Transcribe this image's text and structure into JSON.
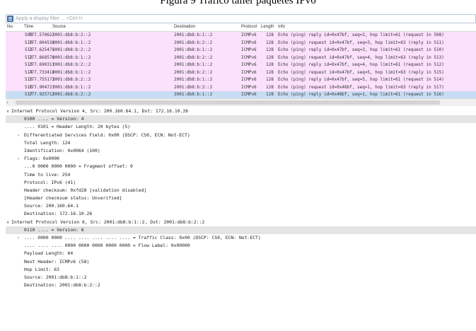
{
  "caption": "Figura 9 Tráfico taller paquetes IPv6",
  "filter": {
    "placeholder": "Apply a display filter ... <Ctrl-/>"
  },
  "columns": {
    "no": "No.",
    "time": "Time",
    "source": "Source",
    "destination": "Destination",
    "protocol": "Protocol",
    "length": "Length",
    "info": "Info"
  },
  "packets": [
    {
      "no": "509",
      "time": "777.570622",
      "src": "2001:db8:b:2::2",
      "dst": "2001:db8:b:1::2",
      "proto": "ICMPv6",
      "len": "128",
      "info": "Echo (ping) reply id=0x47bf, seq=2, hop limit=61 (request in 508)"
    },
    {
      "no": "510",
      "time": "777.604530",
      "src": "2001:db8:b:1::2",
      "dst": "2001:db8:b:2::2",
      "proto": "ICMPv6",
      "len": "128",
      "info": "Echo (ping) request id=0x47bf, seq=3, hop limit=63 (reply in 511)"
    },
    {
      "no": "511",
      "time": "777.625475",
      "src": "2001:db8:b:2::2",
      "dst": "2001:db8:b:1::2",
      "proto": "ICMPv6",
      "len": "128",
      "info": "Echo (ping) reply id=0x47bf, seq=3, hop limit=61 (request in 510)"
    },
    {
      "no": "512",
      "time": "777.668570",
      "src": "2001:db8:b:1::2",
      "dst": "2001:db8:b:2::2",
      "proto": "ICMPv6",
      "len": "128",
      "info": "Echo (ping) request id=0x47bf, seq=4, hop limit=63 (reply in 513)"
    },
    {
      "no": "513",
      "time": "777.690311",
      "src": "2001:db8:b:2::2",
      "dst": "2001:db8:b:1::2",
      "proto": "ICMPv6",
      "len": "128",
      "info": "Echo (ping) reply id=0x47bf, seq=4, hop limit=61 (request in 512)"
    },
    {
      "no": "514",
      "time": "777.733410",
      "src": "2001:db8:b:1::2",
      "dst": "2001:db8:b:2::2",
      "proto": "ICMPv6",
      "len": "128",
      "info": "Echo (ping) request id=0x47bf, seq=5, hop limit=63 (reply in 515)"
    },
    {
      "no": "515",
      "time": "777.755173",
      "src": "2001:db8:b:2::2",
      "dst": "2001:db8:b:1::2",
      "proto": "ICMPv6",
      "len": "128",
      "info": "Echo (ping) reply id=0x47bf, seq=5, hop limit=61 (request in 514)"
    },
    {
      "no": "516",
      "time": "777.904727",
      "src": "2001:db8:b:1::2",
      "dst": "2001:db8:b:2::2",
      "proto": "ICMPv6",
      "len": "128",
      "info": "Echo (ping) request id=0x48bf, seq=1, hop limit=63 (reply in 517)"
    },
    {
      "no": "517",
      "time": "777.925712",
      "src": "2001:db8:b:2::2",
      "dst": "2001:db8:b:1::2",
      "proto": "ICMPv6",
      "len": "128",
      "info": "Echo (ping) reply id=0x48bf, seq=1, hop limit=61 (request in 516)"
    }
  ],
  "details": [
    {
      "tw": "∨",
      "text": "Internet Protocol Version 4, Src: 200.160.64.1, Dst: 172.16.10.26",
      "indent": 0
    },
    {
      "tw": "",
      "text": "0100 .... = Version: 4",
      "indent": 1,
      "hl": true
    },
    {
      "tw": "",
      "text": ".... 0101 = Header Length: 20 bytes (5)",
      "indent": 1
    },
    {
      "tw": "›",
      "text": "Differentiated Services Field: 0x00 (DSCP: CS0, ECN: Not-ECT)",
      "indent": 1
    },
    {
      "tw": "",
      "text": "Total Length: 124",
      "indent": 1
    },
    {
      "tw": "",
      "text": "Identification: 0x0064 (100)",
      "indent": 1
    },
    {
      "tw": "›",
      "text": "Flags: 0x0000",
      "indent": 1
    },
    {
      "tw": "",
      "text": "...0 0000 0000 0000 = Fragment offset: 0",
      "indent": 1
    },
    {
      "tw": "",
      "text": "Time to live: 254",
      "indent": 1
    },
    {
      "tw": "",
      "text": "Protocol: IPv6 (41)",
      "indent": 1
    },
    {
      "tw": "",
      "text": "Header checksum: 0xfd28 [validation disabled]",
      "indent": 1
    },
    {
      "tw": "",
      "text": "[Header checksum status: Unverified]",
      "indent": 1
    },
    {
      "tw": "",
      "text": "Source: 200.160.64.1",
      "indent": 1
    },
    {
      "tw": "",
      "text": "Destination: 172.16.10.26",
      "indent": 1
    },
    {
      "tw": "∨",
      "text": "Internet Protocol Version 6, Src: 2001:db8:b:1::2, Dst: 2001:db8:b:2::2",
      "indent": 0
    },
    {
      "tw": "",
      "text": "0110 .... = Version: 6",
      "indent": 1,
      "hl": true
    },
    {
      "tw": "›",
      "text": ".... 0000 0000 .... .... .... .... .... = Traffic Class: 0x00 (DSCP: CS0, ECN: Not-ECT)",
      "indent": 1
    },
    {
      "tw": "",
      "text": ".... .... .... 0000 0000 0000 0000 0000 = Flow Label: 0x00000",
      "indent": 1
    },
    {
      "tw": "",
      "text": "Payload Length: 64",
      "indent": 1
    },
    {
      "tw": "",
      "text": "Next Header: ICMPv6 (58)",
      "indent": 1
    },
    {
      "tw": "",
      "text": "Hop Limit: 63",
      "indent": 1
    },
    {
      "tw": "",
      "text": "Source: 2001:db8:b:1::2",
      "indent": 1
    },
    {
      "tw": "",
      "text": "Destination: 2001:db8:b:2::2",
      "indent": 1
    }
  ],
  "colors": {
    "row_bg": "#fbe1fc",
    "selected_bg": "#c7ddf4",
    "detail_highlight": "#e4e4e4"
  }
}
